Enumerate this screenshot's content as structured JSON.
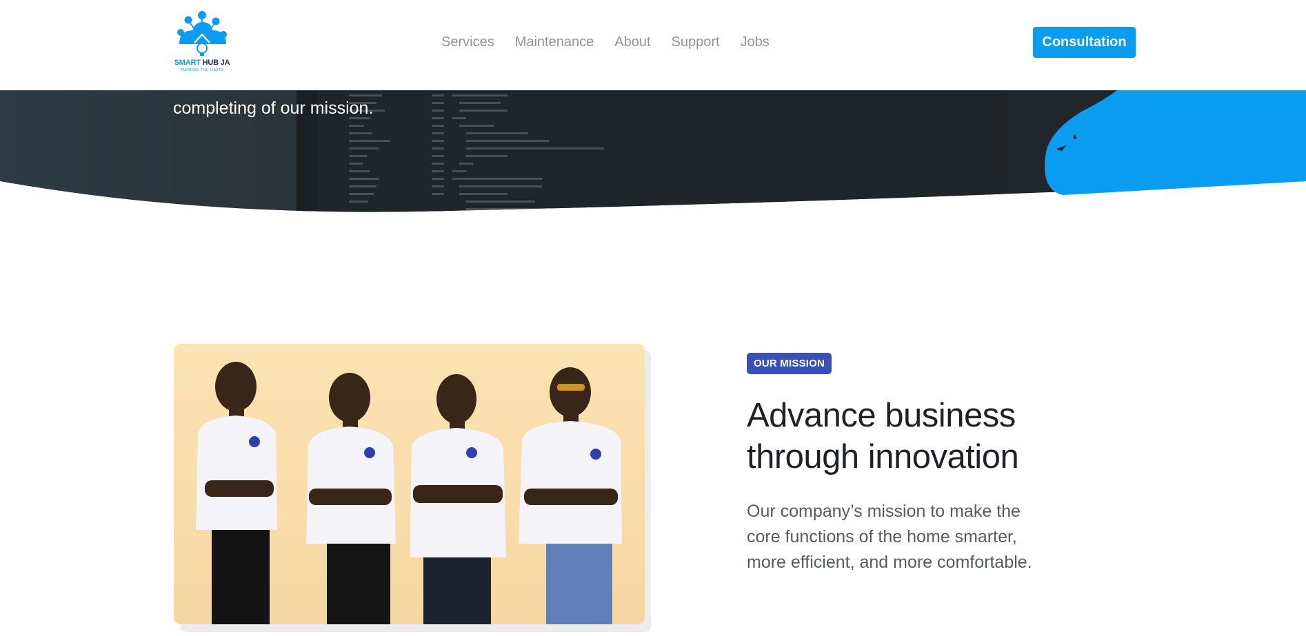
{
  "header": {
    "logo": {
      "name_part1": "SMART",
      "name_part2": " HUB JA",
      "tagline": "PUSHING THE LIMITS"
    },
    "nav": [
      "Services",
      "Maintenance",
      "About",
      "Support",
      "Jobs"
    ],
    "cta_label": "Consultation"
  },
  "hero": {
    "text": "completing of our mission."
  },
  "mission": {
    "badge": "OUR MISSION",
    "title": "Advance business through innovation",
    "description": "Our company’s mission to make the core functions of the home smarter, more efficient, and more comfortable."
  },
  "colors": {
    "accent": "#0a9cf0",
    "badge": "#3a4fb8",
    "hero_dark": "#22282d",
    "nav_text": "#8e939a"
  },
  "icons": [
    "smart-hub-logo-icon"
  ]
}
